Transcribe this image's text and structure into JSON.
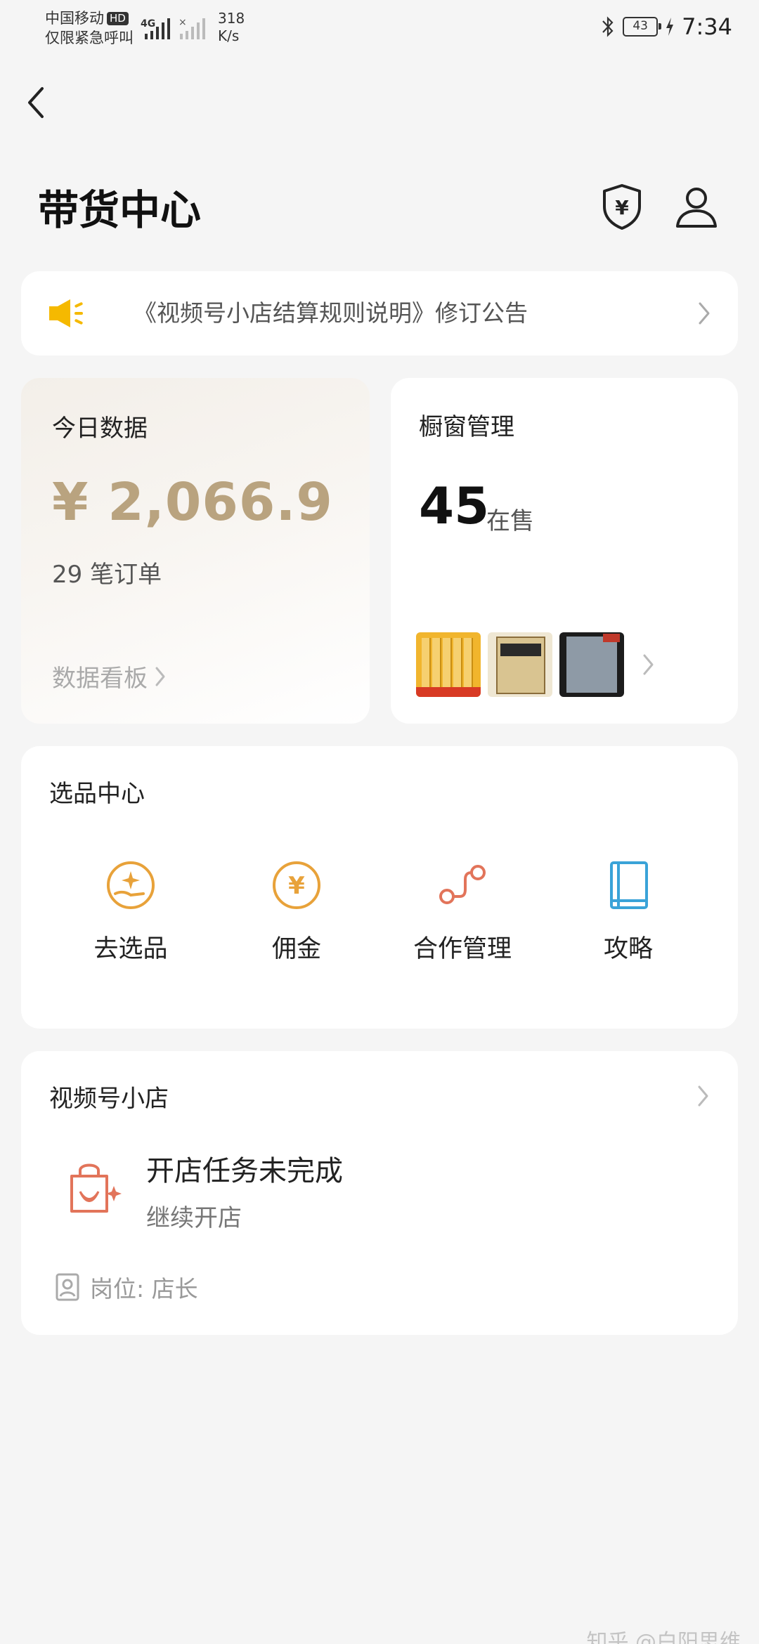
{
  "status_bar": {
    "carrier": "中国移动",
    "hd_badge": "HD",
    "emergency": "仅限紧急呼叫",
    "network_type": "4G",
    "speed_value": "318",
    "speed_unit": "K/s",
    "battery": "43",
    "time": "7:34"
  },
  "header": {
    "title": "带货中心"
  },
  "notice": {
    "text": "《视频号小店结算规则说明》修订公告"
  },
  "today_data": {
    "label": "今日数据",
    "amount": "¥ 2,066.9",
    "orders": "29 笔订单",
    "board_link": "数据看板"
  },
  "window_mgmt": {
    "label": "橱窗管理",
    "count": "45",
    "unit": "在售",
    "thumbnail_count": 3
  },
  "select_center": {
    "label": "选品中心",
    "items": [
      {
        "label": "去选品",
        "icon": "hand-sparkle-icon"
      },
      {
        "label": "佣金",
        "icon": "yen-circle-icon"
      },
      {
        "label": "合作管理",
        "icon": "connection-icon"
      },
      {
        "label": "攻略",
        "icon": "book-icon"
      }
    ]
  },
  "store": {
    "label": "视频号小店",
    "task": "开店任务未完成",
    "continue": "继续开店",
    "role": "岗位: 店长"
  },
  "watermark": "知乎 @白阳思维",
  "colors": {
    "amount_gold": "#b9a37f",
    "speaker_yellow": "#f5b900",
    "icon_orange": "#e8a23a",
    "icon_coral": "#e2745a",
    "icon_blue": "#3aa3d8"
  }
}
